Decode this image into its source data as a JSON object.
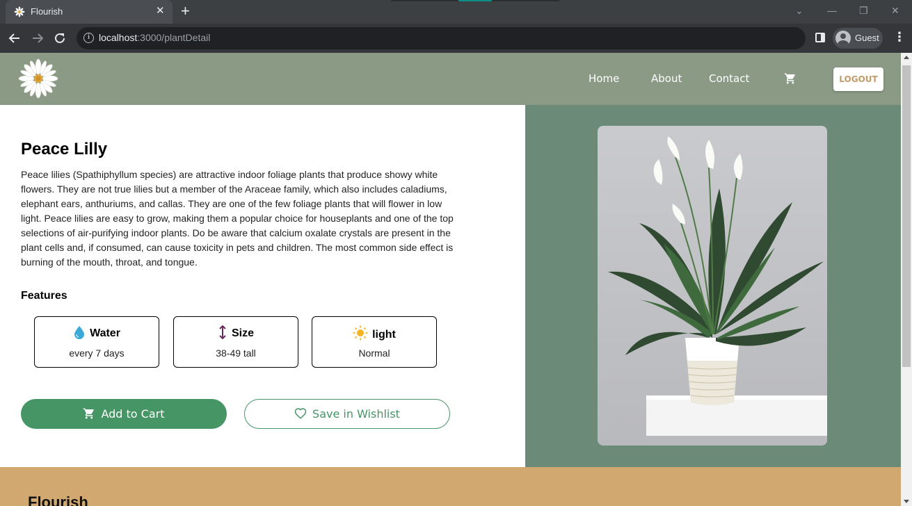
{
  "browser": {
    "tab_title": "Flourish",
    "url_host": "localhost",
    "url_path": ":3000/plantDetail",
    "profile_label": "Guest"
  },
  "header": {
    "nav": [
      "Home",
      "About",
      "Contact"
    ],
    "logout_label": "LOGOUT"
  },
  "plant": {
    "name": "Peace Lilly",
    "description": "Peace lilies (Spathiphyllum species) are attractive indoor foliage plants that produce showy white flowers. They are not true lilies but a member of the Araceae family, which also includes caladiums, elephant ears, anthuriums, and callas. They are one of the few foliage plants that will flower in low light. Peace lilies are easy to grow, making them a popular choice for houseplants and one of the top selections of air-purifying indoor plants. Do be aware that calcium oxalate crystals are present in the plant cells and, if consumed, can cause toxicity in pets and children. The most common side effect is burning of the mouth, throat, and tongue.",
    "features_title": "Features",
    "features": [
      {
        "icon": "water-drop-icon",
        "label": "Water",
        "value": "every 7 days"
      },
      {
        "icon": "height-arrow-icon",
        "label": "Size",
        "value": "38-49 tall"
      },
      {
        "icon": "sun-icon",
        "label": "light",
        "value": "Normal"
      }
    ]
  },
  "actions": {
    "add_to_cart": "Add to Cart",
    "save_wishlist": "Save in Wishlist"
  },
  "footer": {
    "brand": "Flourish"
  },
  "colors": {
    "header_bg": "#8a9a85",
    "image_panel_bg": "#6b8a77",
    "primary_green": "#459565",
    "footer_bg": "#d1a970",
    "logout_text": "#c39b6b"
  }
}
